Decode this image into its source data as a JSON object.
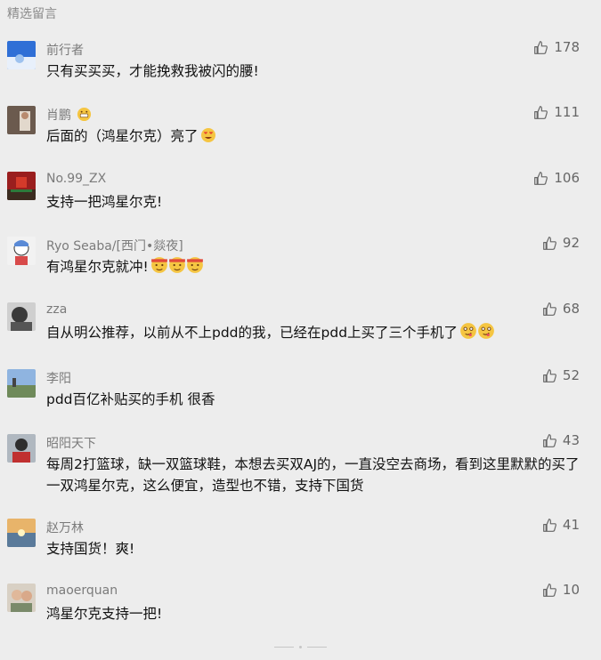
{
  "section_title": "精选留言",
  "comments": [
    {
      "nick": "前行者",
      "text": "只有买买买，才能挽救我被闪的腰!",
      "likes": "178"
    },
    {
      "nick": "肖鹏",
      "text": "后面的（鸿星尔克）亮了",
      "likes": "111"
    },
    {
      "nick": "No.99_ZX",
      "text": "支持一把鸿星尔克!",
      "likes": "106"
    },
    {
      "nick": "Ryo Seaba/[西门•燚夜]",
      "text": "有鸿星尔克就冲!",
      "likes": "92"
    },
    {
      "nick": "zza",
      "text": "自从明公推荐，以前从不上pdd的我，已经在pdd上买了三个手机了",
      "likes": "68"
    },
    {
      "nick": "李阳",
      "text": "pdd百亿补贴买的手机 很香",
      "likes": "52"
    },
    {
      "nick": "昭阳天下",
      "text": "每周2打篮球，缺一双篮球鞋，本想去买双AJ的，一直没空去商场，看到这里默默的买了一双鸿星尔克，这么便宜，造型也不错，支持下国货",
      "likes": "43"
    },
    {
      "nick": "赵万林",
      "text": "支持国货！爽!",
      "likes": "41"
    },
    {
      "nick": "maoerquan",
      "text": "鸿星尔克支持一把!",
      "likes": "10"
    }
  ]
}
